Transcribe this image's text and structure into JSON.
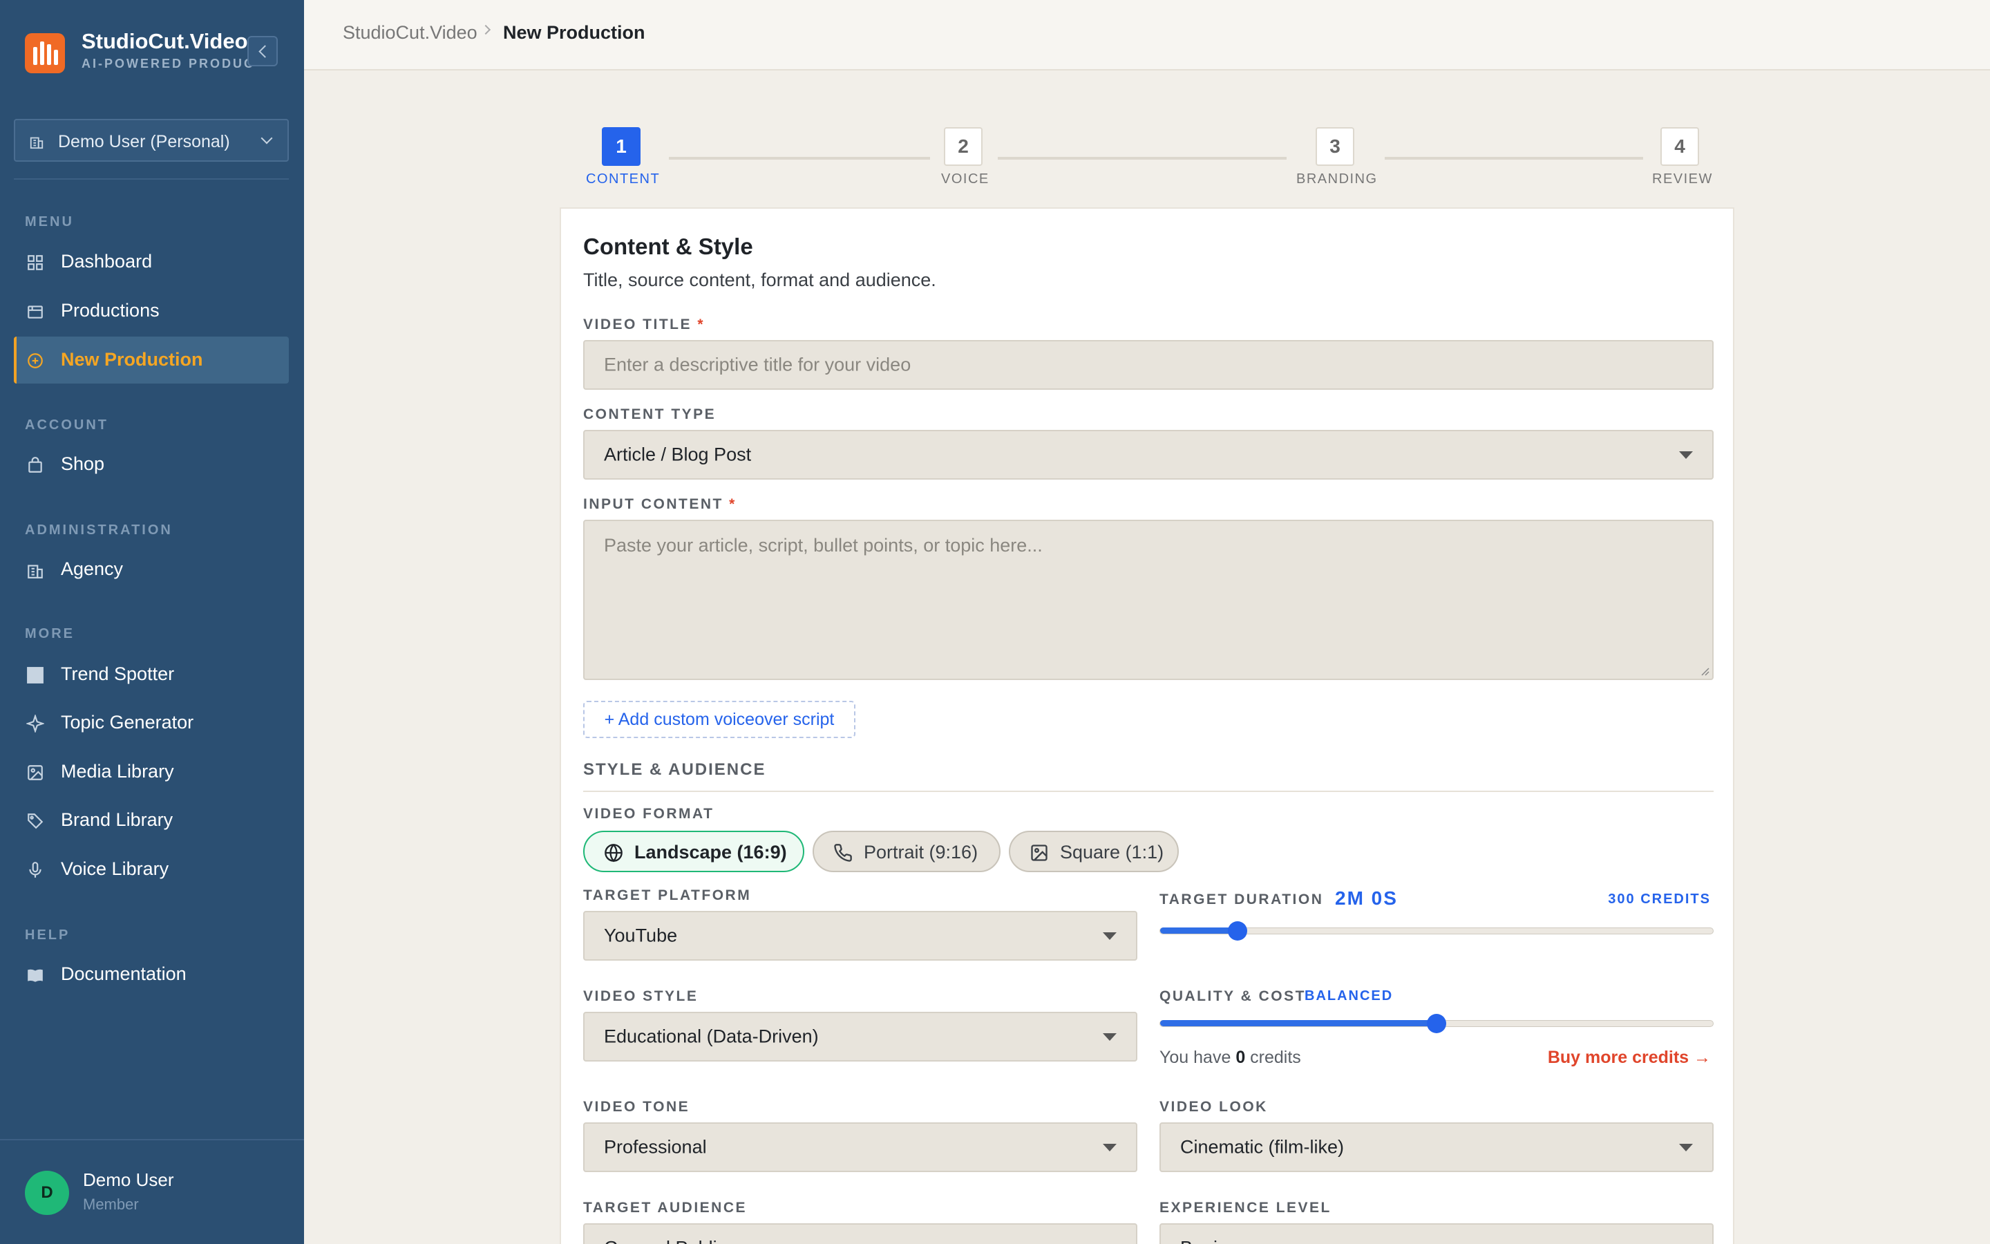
{
  "brand": {
    "title": "StudioCut.Video",
    "subtitle": "AI-POWERED PRODUCTIONS"
  },
  "workspace": {
    "label": "Demo User (Personal)"
  },
  "sidebar": {
    "sections": [
      {
        "label": "MENU"
      },
      {
        "label": "ACCOUNT"
      },
      {
        "label": "ADMINISTRATION"
      },
      {
        "label": "MORE"
      },
      {
        "label": "HELP"
      }
    ],
    "items": [
      {
        "label": "Dashboard",
        "icon": "grid-icon"
      },
      {
        "label": "Productions",
        "icon": "folder-icon"
      },
      {
        "label": "New Production",
        "icon": "plus-circle-icon",
        "active": true
      },
      {
        "label": "Shop",
        "icon": "shopping-bag-icon"
      },
      {
        "label": "Agency",
        "icon": "building-icon"
      },
      {
        "label": "Trend Spotter",
        "icon": "square-icon"
      },
      {
        "label": "Topic Generator",
        "icon": "sparkle-icon"
      },
      {
        "label": "Media Library",
        "icon": "image-icon"
      },
      {
        "label": "Brand Library",
        "icon": "tag-icon"
      },
      {
        "label": "Voice Library",
        "icon": "microphone-icon"
      },
      {
        "label": "Documentation",
        "icon": "book-icon"
      }
    ]
  },
  "user": {
    "initial": "D",
    "name": "Demo User",
    "role": "Member"
  },
  "breadcrumb": {
    "root": "StudioCut.Video",
    "current": "New Production"
  },
  "stepper": {
    "steps": [
      {
        "number": "1",
        "label": "CONTENT",
        "active": true
      },
      {
        "number": "2",
        "label": "VOICE"
      },
      {
        "number": "3",
        "label": "BRANDING"
      },
      {
        "number": "4",
        "label": "REVIEW"
      }
    ]
  },
  "card": {
    "title": "Content & Style",
    "subtitle": "Title, source content, format and audience."
  },
  "form": {
    "video_title": {
      "label": "VIDEO TITLE",
      "required": "*",
      "placeholder": "Enter a descriptive title for your video"
    },
    "content_type": {
      "label": "CONTENT TYPE",
      "value": "Article / Blog Post"
    },
    "input_content": {
      "label": "INPUT CONTENT",
      "required": "*",
      "placeholder": "Paste your article, script, bullet points, or topic here..."
    },
    "add_script": "+ Add custom voiceover script",
    "style_section": "STYLE & AUDIENCE",
    "video_format": {
      "label": "VIDEO FORMAT",
      "options": [
        {
          "label": "Landscape (16:9)",
          "icon": "globe-icon",
          "selected": true
        },
        {
          "label": "Portrait (9:16)",
          "icon": "phone-icon"
        },
        {
          "label": "Square (1:1)",
          "icon": "image-icon"
        }
      ]
    },
    "target_platform": {
      "label": "TARGET PLATFORM",
      "value": "YouTube"
    },
    "target_duration": {
      "label": "TARGET DURATION",
      "value": "2M 0S",
      "cost": "300 CREDITS",
      "level": 0.14
    },
    "video_style": {
      "label": "VIDEO STYLE",
      "value": "Educational (Data-Driven)"
    },
    "quality_cost": {
      "label": "QUALITY & COST",
      "value": "BALANCED",
      "level": 0.5
    },
    "credits": {
      "prefix": "You have",
      "amount": "0",
      "suffix": "credits",
      "buy_label": "Buy more credits →"
    },
    "video_tone": {
      "label": "VIDEO TONE",
      "value": "Professional"
    },
    "video_look": {
      "label": "VIDEO LOOK",
      "value": "Cinematic (film-like)"
    },
    "target_audience": {
      "label": "TARGET AUDIENCE",
      "value": "General Public"
    },
    "experience_level": {
      "label": "EXPERIENCE LEVEL",
      "value": "Beginner"
    }
  },
  "colors": {
    "sidebar": "#2b4f72",
    "accent": "#2563eb",
    "active_nav": "#f5a623",
    "brand": "#f06a25",
    "danger": "#e0452b",
    "success": "#1fb877"
  }
}
